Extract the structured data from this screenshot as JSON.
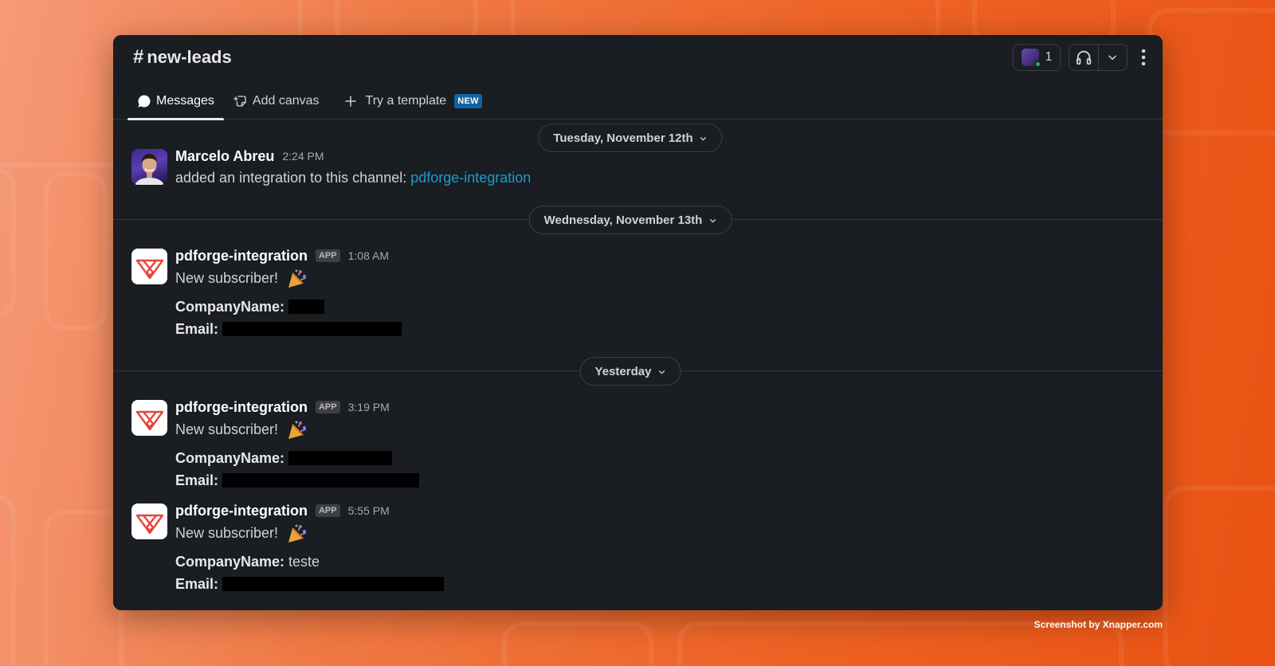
{
  "channel": {
    "name": "new-leads",
    "member_count": "1"
  },
  "tabs": [
    {
      "label": "Messages"
    },
    {
      "label": "Add canvas"
    },
    {
      "label": "Try a template",
      "badge": "NEW"
    }
  ],
  "date_dividers": [
    "Tuesday, November 12th",
    "Wednesday, November 13th",
    "Yesterday"
  ],
  "messages": [
    {
      "author": "Marcelo Abreu",
      "time": "2:24 PM",
      "text": "added an integration to this channel: ",
      "link": "pdforge-integration"
    },
    {
      "author": "pdforge-integration",
      "app_badge": "APP",
      "time": "1:08 AM",
      "text": "New subscriber!",
      "company_label": "CompanyName:",
      "company_value": "",
      "email_label": "Email:"
    },
    {
      "author": "pdforge-integration",
      "app_badge": "APP",
      "time": "3:19 PM",
      "text": "New subscriber!",
      "company_label": "CompanyName:",
      "company_value": "",
      "email_label": "Email:"
    },
    {
      "author": "pdforge-integration",
      "app_badge": "APP",
      "time": "5:55 PM",
      "text": "New subscriber!",
      "company_label": "CompanyName:",
      "company_value": "teste",
      "email_label": "Email:"
    }
  ],
  "watermark": "Screenshot by Xnapper.com",
  "colors": {
    "window_bg": "#1a1d21",
    "link": "#1d9bd1",
    "new_badge": "#1164a3",
    "brand_red": "#e8443a"
  },
  "icons": [
    "hash-icon",
    "chat-bubble-icon",
    "canvas-icon",
    "plus-icon",
    "headphones-icon",
    "chevron-down-icon",
    "kebab-menu-icon",
    "confetti-icon",
    "pdforge-logo-icon"
  ]
}
